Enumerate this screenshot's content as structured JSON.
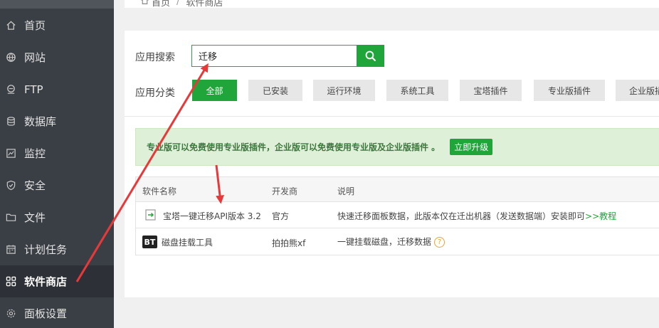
{
  "sidebar": {
    "items": [
      {
        "label": "首页",
        "icon": "home-icon"
      },
      {
        "label": "网站",
        "icon": "globe-icon"
      },
      {
        "label": "FTP",
        "icon": "ftp-icon"
      },
      {
        "label": "数据库",
        "icon": "database-icon"
      },
      {
        "label": "监控",
        "icon": "monitor-icon"
      },
      {
        "label": "安全",
        "icon": "shield-icon"
      },
      {
        "label": "文件",
        "icon": "folder-icon"
      },
      {
        "label": "计划任务",
        "icon": "calendar-icon"
      },
      {
        "label": "软件商店",
        "icon": "grid-icon",
        "active": true
      },
      {
        "label": "面板设置",
        "icon": "gear-icon"
      }
    ]
  },
  "breadcrumb": {
    "home": "首页",
    "sep": "/",
    "current": "软件商店"
  },
  "search": {
    "label": "应用搜索",
    "value": "迁移"
  },
  "categories": {
    "label": "应用分类",
    "items": [
      "全部",
      "已安装",
      "运行环境",
      "系统工具",
      "宝塔插件",
      "专业版插件",
      "企业版插件"
    ]
  },
  "alert": {
    "text": "专业版可以免费使用专业版插件，企业版可以免费使用专业版及企业版插件 。",
    "button": "立即升级"
  },
  "table": {
    "headers": [
      "软件名称",
      "开发商",
      "说明"
    ],
    "rows": [
      {
        "name": "宝塔一键迁移API版本 3.2",
        "developer": "官方",
        "desc": "快速迁移面板数据，此版本仅在迁出机器（发送数据端）安装即可",
        "link": ">>教程",
        "badge": ""
      },
      {
        "name": "磁盘挂载工具",
        "developer": "拍拍熊xf",
        "desc": "一键挂载磁盘，迁移数据",
        "badge": "BT",
        "help": "?"
      }
    ]
  },
  "colors": {
    "accent": "#20a53a",
    "sidebar": "#3a3e45",
    "annotation": "#e8393a"
  }
}
